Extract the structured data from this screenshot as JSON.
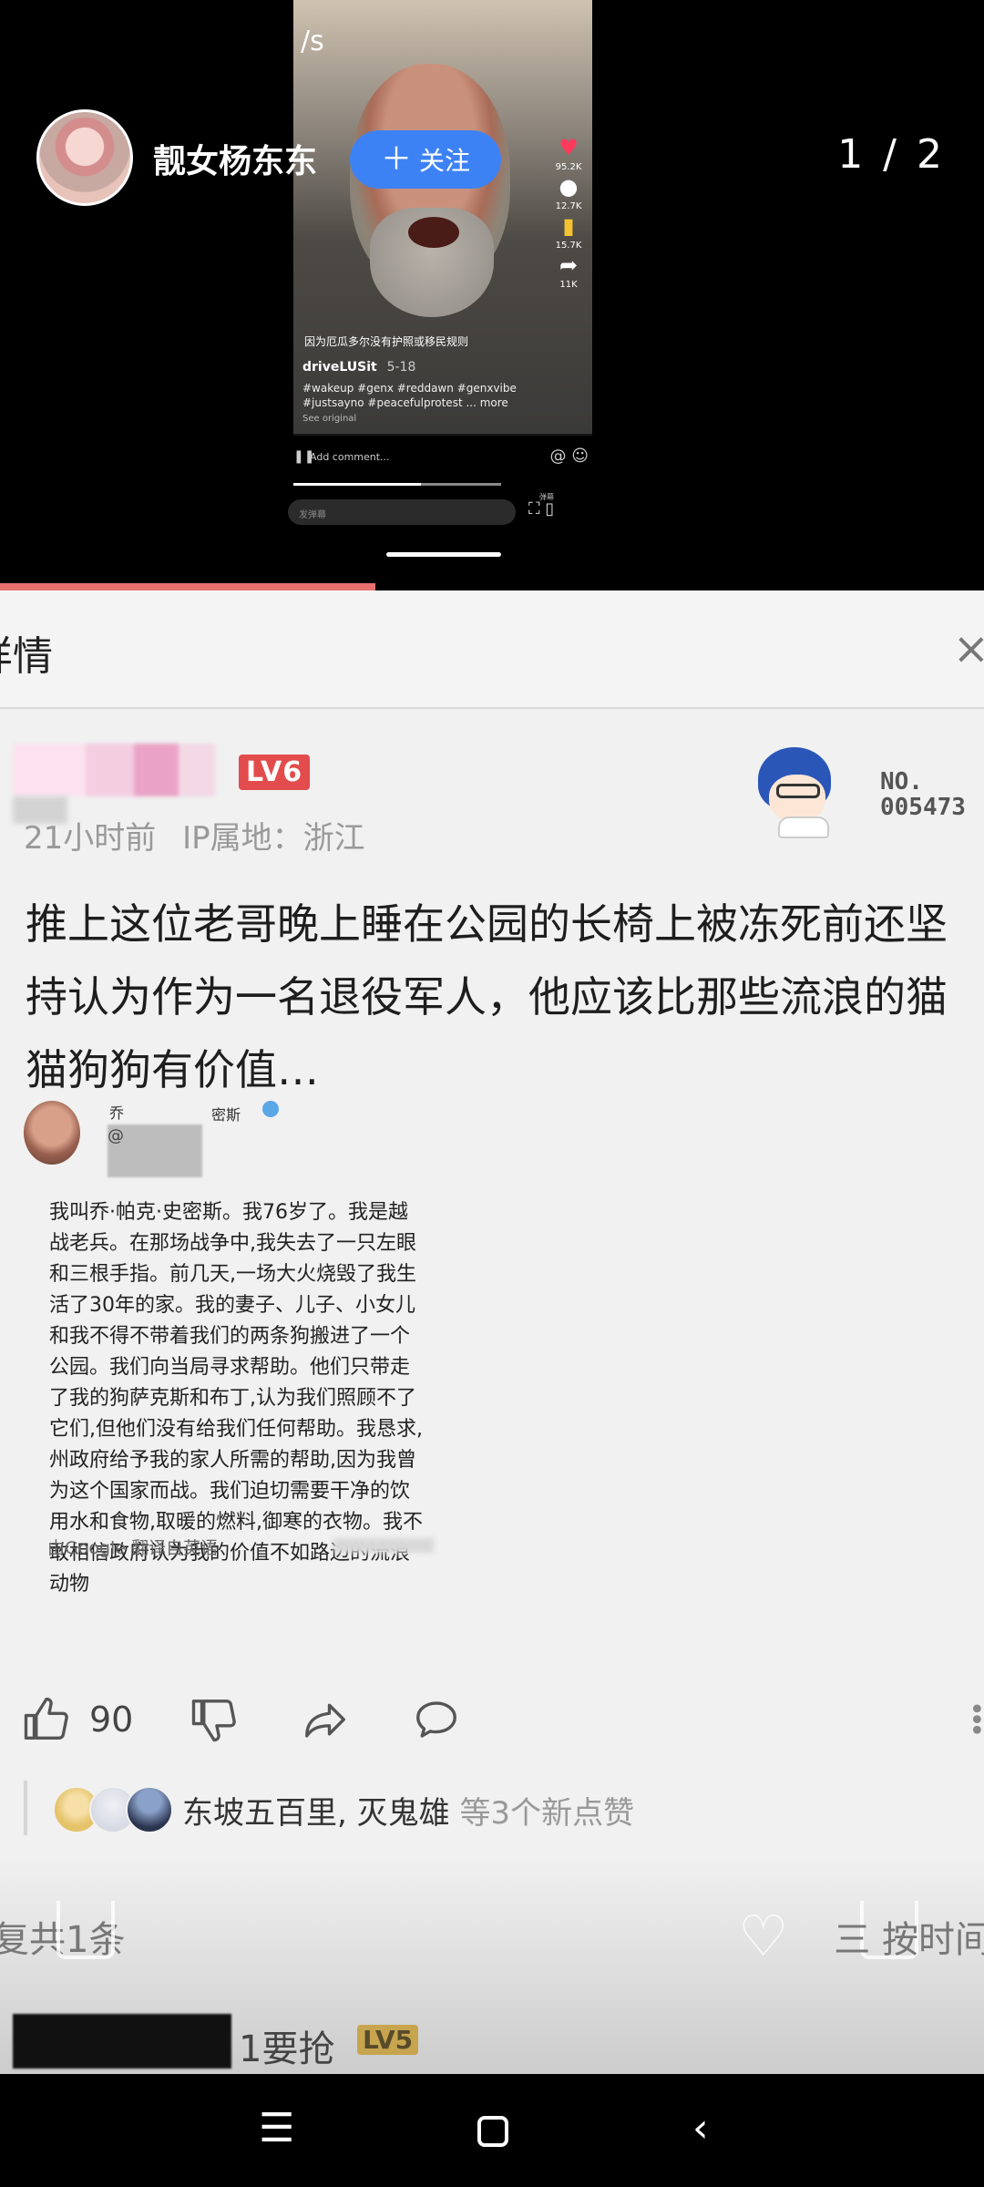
{
  "header": {
    "author": "靓女杨东东",
    "follow_label": "关注",
    "pager": "1 / 2"
  },
  "video": {
    "status_fragment": "/s",
    "caption": "因为厄瓜多尔没有护照或移民规则",
    "author": "driveLUSit",
    "date": "5-18",
    "tags": "#wakeup #genx #reddawn #genxvibe #justsayno #peacefulprotest ... more",
    "see_original": "See original",
    "likes": "95.2K",
    "comments": "12.7K",
    "saves": "15.7K",
    "shares": "11K",
    "comment_placeholder": "Add comment...",
    "danmaku_placeholder": "发弹幕",
    "tag_small": "弹幕"
  },
  "panel": {
    "title": "详情",
    "close": "×"
  },
  "reply": {
    "level": "LV6",
    "time": "21小时前",
    "ip": "IP属地：浙江",
    "badge_no_label": "NO.",
    "badge_no_value": "005473",
    "text": "推上这位老哥晚上睡在公园的长椅上被冻死前还坚持认为作为一名退役军人，他应该比那些流浪的猫猫狗狗有价值…",
    "tweet": {
      "name_left": "乔",
      "name_right": "密斯",
      "handle": "@",
      "body": "我叫乔·帕克·史密斯。我76岁了。我是越战老兵。在那场战争中,我失去了一只左眼和三根手指。前几天,一场大火烧毁了我生活了30年的家。我的妻子、儿子、小女儿和我不得不带着我们的两条狗搬进了一个公园。我们向当局寻求帮助。他们只带走了我的狗萨克斯和布丁,认为我们照顾不了它们,但他们没有给我们任何帮助。我恳求,州政府给予我的家人所需的帮助,因为我曾为这个国家而战。我们迫切需要干净的饮用水和食物,取暖的燃料,御寒的衣物。我不敢相信政府认为我的价值不如路边的流浪动物",
      "footer": "由Google 翻译自英语"
    },
    "like_count": "90",
    "likers": "东坡五百里, 灭鬼雄",
    "likers_suffix": "等3个新点赞"
  },
  "footer": {
    "reply_count": "复共1条",
    "sort": "三 按时间",
    "next_text": "1要抢",
    "next_level": "LV5"
  }
}
